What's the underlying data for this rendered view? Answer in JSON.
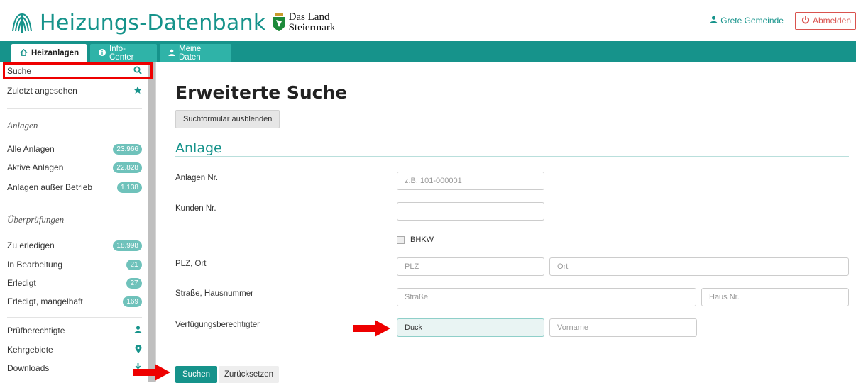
{
  "header": {
    "app_title": "Heizungs-Datenbank",
    "land_line1": "Das Land",
    "land_line2": "Steiermark",
    "user_name": "Grete Gemeinde",
    "logout_label": "Abmelden"
  },
  "tabs": [
    {
      "label": "Heizanlagen",
      "active": true
    },
    {
      "label": "Info-Center",
      "active": false
    },
    {
      "label": "Meine Daten",
      "active": false
    }
  ],
  "sidebar": {
    "search_label": "Suche",
    "recent_label": "Zuletzt angesehen",
    "anlagen_heading": "Anlagen",
    "anlagen_items": [
      {
        "label": "Alle Anlagen",
        "count": "23.966"
      },
      {
        "label": "Aktive Anlagen",
        "count": "22.828"
      },
      {
        "label": "Anlagen außer Betrieb",
        "count": "1.138"
      }
    ],
    "ueberpruefungen_heading": "Überprüfungen",
    "ueberpruefungen_items": [
      {
        "label": "Zu erledigen",
        "count": "18.998"
      },
      {
        "label": "In Bearbeitung",
        "count": "21"
      },
      {
        "label": "Erledigt",
        "count": "27"
      },
      {
        "label": "Erledigt, mangelhaft",
        "count": "169"
      }
    ],
    "links": [
      {
        "label": "Prüfberechtigte",
        "icon": "user-icon"
      },
      {
        "label": "Kehrgebiete",
        "icon": "map-marker-icon"
      },
      {
        "label": "Downloads",
        "icon": "download-icon"
      }
    ]
  },
  "main": {
    "page_title": "Erweiterte Suche",
    "toggle_form_label": "Suchformular ausblenden",
    "section_title": "Anlage",
    "fields": {
      "anlagen_nr_label": "Anlagen Nr.",
      "anlagen_nr_placeholder": "z.B. 101-000001",
      "kunden_nr_label": "Kunden Nr.",
      "kunden_nr_value": "",
      "bhkw_label": "BHKW",
      "plz_ort_label": "PLZ, Ort",
      "plz_placeholder": "PLZ",
      "ort_placeholder": "Ort",
      "strasse_label": "Straße, Hausnummer",
      "strasse_placeholder": "Straße",
      "hausnr_placeholder": "Haus Nr.",
      "verfueg_label": "Verfügungsberechtigter",
      "name_value": "Duck",
      "vorname_placeholder": "Vorname"
    },
    "search_button": "Suchen",
    "reset_button": "Zurücksetzen"
  },
  "colors": {
    "brand": "#16938b",
    "annotation": "#e00000",
    "logout": "#d9534f"
  }
}
